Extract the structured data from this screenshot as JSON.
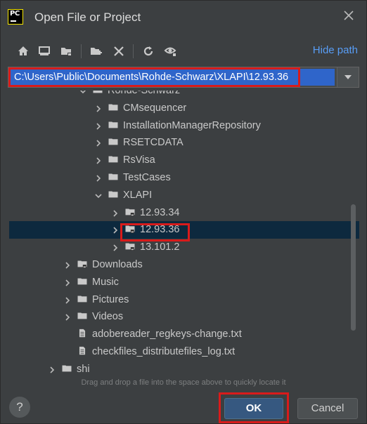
{
  "dialog": {
    "title": "Open File or Project",
    "logo_text": "PC",
    "hide_path_label": "Hide path"
  },
  "toolbar": {
    "icons": [
      "home-icon",
      "desktop-icon",
      "project-folder-icon",
      "new-folder-icon",
      "delete-icon",
      "refresh-icon",
      "show-hidden-icon"
    ]
  },
  "path": {
    "value": "C:\\Users\\Public\\Documents\\Rohde-Schwarz\\XLAPI\\12.93.36"
  },
  "tree": {
    "items": [
      {
        "label": "Rohde-Schwarz",
        "expanded": true,
        "icon": "folder-icon"
      },
      {
        "label": "CMsequencer",
        "expanded": false,
        "icon": "folder-icon"
      },
      {
        "label": "InstallationManagerRepository",
        "expanded": false,
        "icon": "folder-icon"
      },
      {
        "label": "RSETCDATA",
        "expanded": false,
        "icon": "folder-icon"
      },
      {
        "label": "RsVisa",
        "expanded": false,
        "icon": "folder-icon"
      },
      {
        "label": "TestCases",
        "expanded": false,
        "icon": "folder-icon"
      },
      {
        "label": "XLAPI",
        "expanded": true,
        "icon": "folder-icon"
      },
      {
        "label": "12.93.34",
        "expanded": false,
        "icon": "project-folder-icon"
      },
      {
        "label": "12.93.36",
        "expanded": false,
        "icon": "project-folder-icon",
        "selected": true
      },
      {
        "label": "13.101.2",
        "expanded": false,
        "icon": "project-folder-icon"
      },
      {
        "label": "Downloads",
        "expanded": false,
        "icon": "project-folder-icon"
      },
      {
        "label": "Music",
        "expanded": false,
        "icon": "folder-icon"
      },
      {
        "label": "Pictures",
        "expanded": false,
        "icon": "folder-icon"
      },
      {
        "label": "Videos",
        "expanded": false,
        "icon": "folder-icon"
      },
      {
        "label": "adobereader_regkeys-change.txt",
        "icon": "text-file-icon"
      },
      {
        "label": "checkfiles_distributefiles_log.txt",
        "icon": "text-file-icon"
      },
      {
        "label": "shi",
        "expanded": false,
        "icon": "folder-icon"
      }
    ]
  },
  "hint": "Drag and drop a file into the space above to quickly locate it",
  "buttons": {
    "help": "?",
    "ok": "OK",
    "cancel": "Cancel"
  },
  "colors": {
    "background": "#3c3f41",
    "selection": "#0d293e",
    "path_highlight": "#2f65ca",
    "accent_link": "#589df6",
    "annotation_red": "#d81b1b"
  }
}
